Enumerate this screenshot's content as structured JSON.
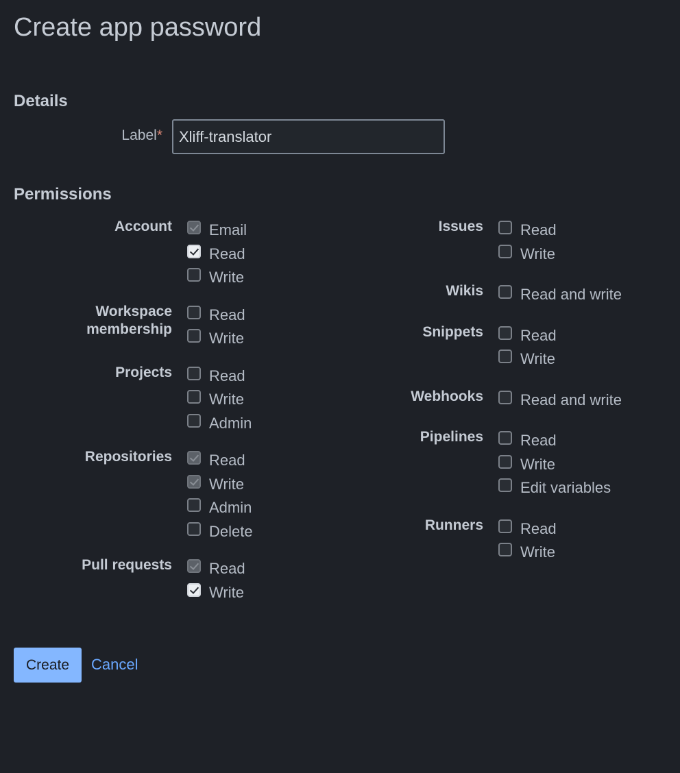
{
  "page_title": "Create app password",
  "details": {
    "heading": "Details",
    "label_field": {
      "label": "Label",
      "required_marker": "*",
      "value": "Xliff-translator"
    }
  },
  "permissions": {
    "heading": "Permissions",
    "left": [
      {
        "label": "Account",
        "options": [
          {
            "label": "Email",
            "state": "checked-disabled"
          },
          {
            "label": "Read",
            "state": "checked"
          },
          {
            "label": "Write",
            "state": "unchecked"
          }
        ]
      },
      {
        "label": "Workspace membership",
        "options": [
          {
            "label": "Read",
            "state": "unchecked"
          },
          {
            "label": "Write",
            "state": "unchecked"
          }
        ]
      },
      {
        "label": "Projects",
        "options": [
          {
            "label": "Read",
            "state": "unchecked"
          },
          {
            "label": "Write",
            "state": "unchecked"
          },
          {
            "label": "Admin",
            "state": "unchecked"
          }
        ]
      },
      {
        "label": "Repositories",
        "options": [
          {
            "label": "Read",
            "state": "checked-disabled"
          },
          {
            "label": "Write",
            "state": "checked-disabled"
          },
          {
            "label": "Admin",
            "state": "unchecked"
          },
          {
            "label": "Delete",
            "state": "unchecked"
          }
        ]
      },
      {
        "label": "Pull requests",
        "options": [
          {
            "label": "Read",
            "state": "checked-disabled"
          },
          {
            "label": "Write",
            "state": "checked"
          }
        ]
      }
    ],
    "right": [
      {
        "label": "Issues",
        "options": [
          {
            "label": "Read",
            "state": "unchecked"
          },
          {
            "label": "Write",
            "state": "unchecked"
          }
        ]
      },
      {
        "label": "Wikis",
        "options": [
          {
            "label": "Read and write",
            "state": "unchecked"
          }
        ]
      },
      {
        "label": "Snippets",
        "options": [
          {
            "label": "Read",
            "state": "unchecked"
          },
          {
            "label": "Write",
            "state": "unchecked"
          }
        ]
      },
      {
        "label": "Webhooks",
        "options": [
          {
            "label": "Read and write",
            "state": "unchecked"
          }
        ]
      },
      {
        "label": "Pipelines",
        "options": [
          {
            "label": "Read",
            "state": "unchecked"
          },
          {
            "label": "Write",
            "state": "unchecked"
          },
          {
            "label": "Edit variables",
            "state": "unchecked"
          }
        ]
      },
      {
        "label": "Runners",
        "options": [
          {
            "label": "Read",
            "state": "unchecked"
          },
          {
            "label": "Write",
            "state": "unchecked"
          }
        ]
      }
    ]
  },
  "actions": {
    "create_label": "Create",
    "cancel_label": "Cancel"
  },
  "colors": {
    "background": "#1e2127",
    "primary_button": "#84b7ff",
    "link": "#6aa8ff",
    "required": "#e08a78"
  }
}
